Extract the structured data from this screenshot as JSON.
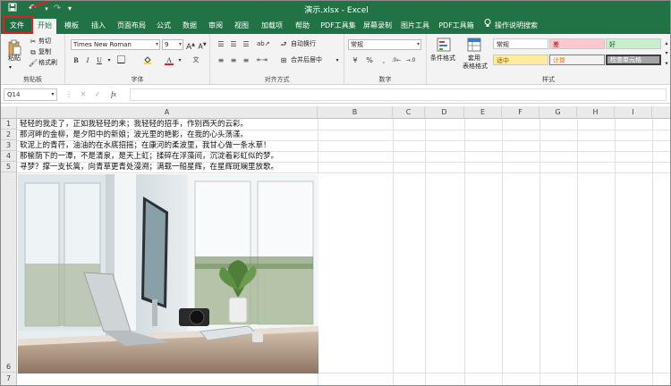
{
  "window": {
    "title": "演示.xlsx  -  Excel"
  },
  "tabs": [
    "文件",
    "开始",
    "模板",
    "插入",
    "页面布局",
    "公式",
    "数据",
    "审阅",
    "视图",
    "加载项",
    "帮助",
    "PDF工具集",
    "屏幕录制",
    "图片工具",
    "PDF工具箱"
  ],
  "tell_me": "操作说明搜索",
  "ribbon": {
    "clipboard": {
      "paste": "粘贴",
      "cut": "剪切",
      "copy": "复制",
      "format_painter": "格式刷",
      "label": "剪贴板"
    },
    "font": {
      "name": "Times New Roman",
      "size": "9",
      "label": "字体"
    },
    "alignment": {
      "wrap": "自动换行",
      "merge": "合并后居中",
      "label": "对齐方式"
    },
    "number": {
      "format": "常规",
      "label": "数字"
    },
    "styles": {
      "cond_format": "条件格式",
      "table_format_1": "套用",
      "table_format_2": "表格格式",
      "cells": [
        "常规",
        "差",
        "好",
        "适中",
        "计算",
        "检查单元格"
      ],
      "label": "样式"
    }
  },
  "formula_bar": {
    "name_box": "Q14",
    "fx": "fx"
  },
  "columns": [
    "A",
    "B",
    "C",
    "D",
    "E",
    "F",
    "G",
    "H",
    "I"
  ],
  "rows": [
    "1",
    "2",
    "3",
    "4",
    "5",
    "6",
    "7"
  ],
  "cells": [
    "轻轻的我走了，正如我轻轻的来；我轻轻的招手，作别西天的云彩。",
    "那河畔的金柳，是夕阳中的新娘；波光里的艳影，在我的心头荡漾。",
    "软泥上的青荇，油油的在水底招摇；在康河的柔波里，我甘心做一条水草！",
    "那榆荫下的一潭，不是清泉，是天上虹；揉碎在浮藻间，沉淀着彩虹似的梦。",
    "寻梦？撑一支长篙，向青草更青处漫溯；满载一船星辉，在星辉斑斓里放歌。"
  ],
  "colors": {
    "excel_green": "#217346",
    "annotation_red": "#e02020"
  }
}
